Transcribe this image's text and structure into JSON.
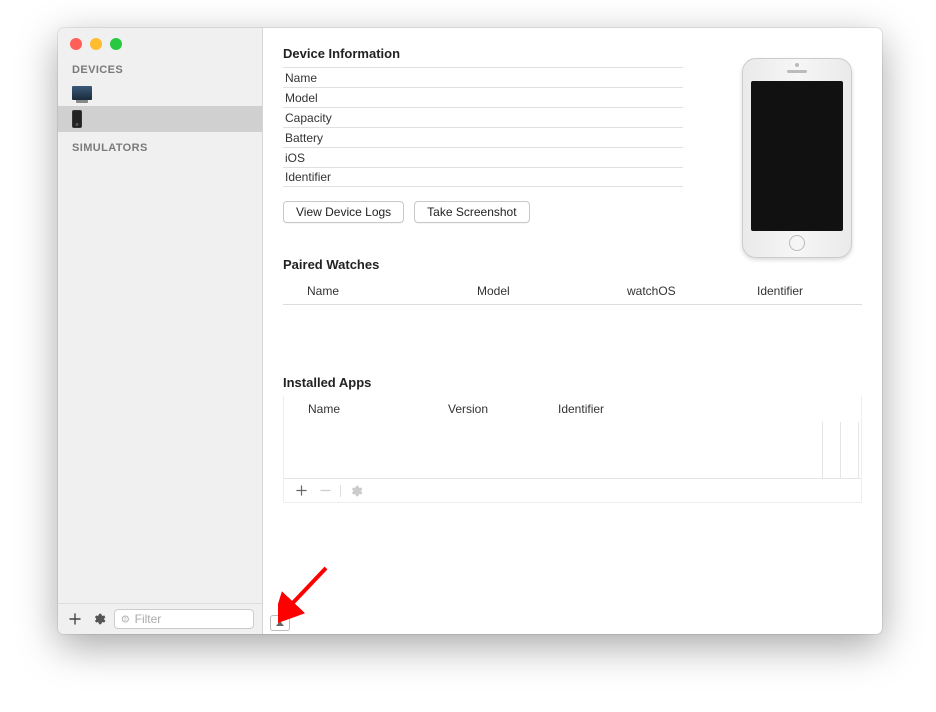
{
  "sidebar": {
    "sections": {
      "devices_header": "DEVICES",
      "simulators_header": "SIMULATORS"
    },
    "filter_placeholder": "Filter"
  },
  "device_info": {
    "title": "Device Information",
    "rows": {
      "name": "Name",
      "model": "Model",
      "capacity": "Capacity",
      "battery": "Battery",
      "ios": "iOS",
      "identifier": "Identifier"
    }
  },
  "actions": {
    "view_logs": "View Device Logs",
    "take_screenshot": "Take Screenshot"
  },
  "paired_watches": {
    "title": "Paired Watches",
    "cols": {
      "name": "Name",
      "model": "Model",
      "watchos": "watchOS",
      "identifier": "Identifier"
    }
  },
  "installed_apps": {
    "title": "Installed Apps",
    "cols": {
      "name": "Name",
      "version": "Version",
      "identifier": "Identifier"
    }
  }
}
